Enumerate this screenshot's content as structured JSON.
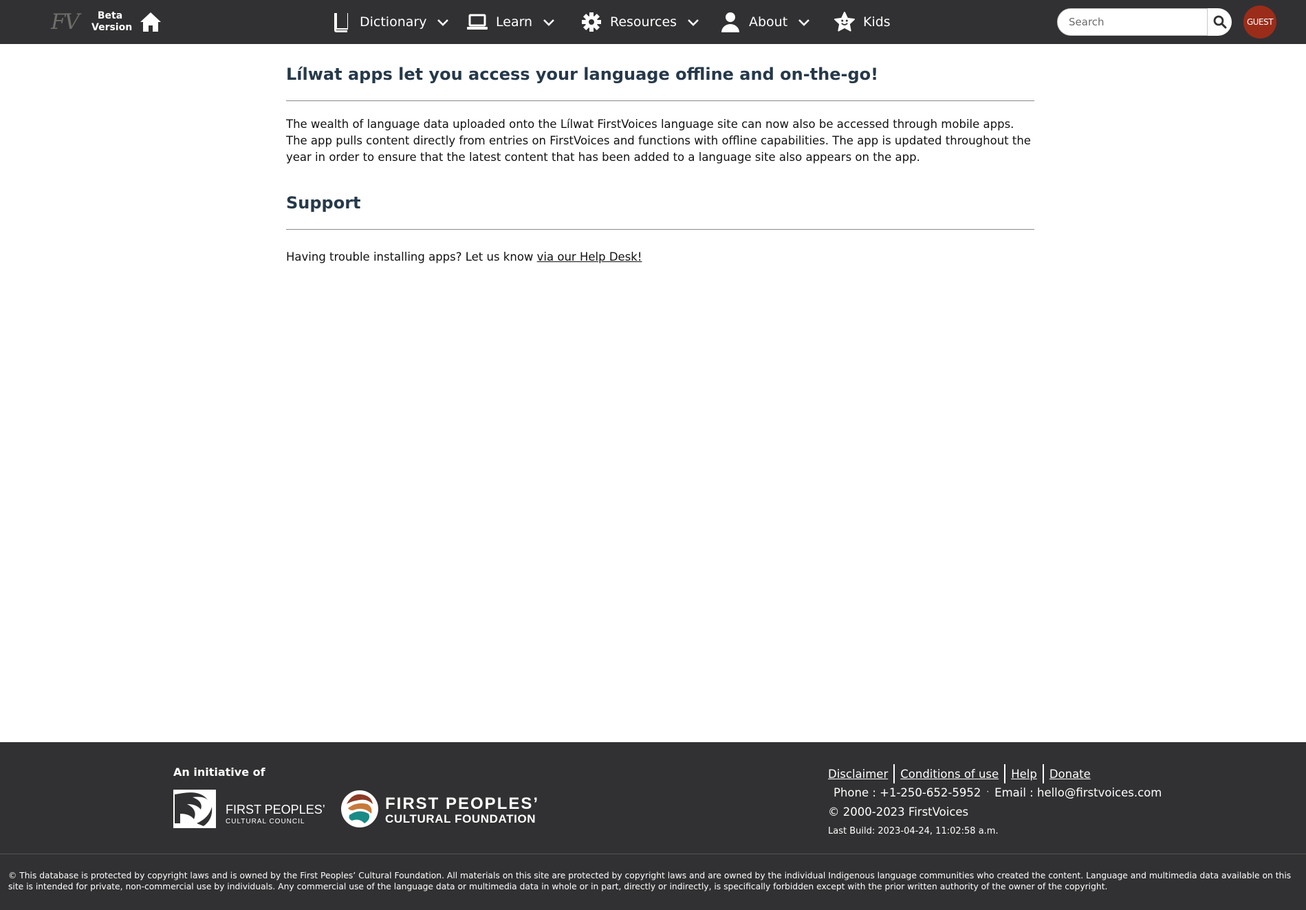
{
  "header": {
    "logo_text": "FV",
    "beta_line1": "Beta",
    "beta_line2": "Version",
    "nav": [
      {
        "label": "Dictionary",
        "icon": "book-icon"
      },
      {
        "label": "Learn",
        "icon": "laptop-icon"
      },
      {
        "label": "Resources",
        "icon": "gear-icon"
      },
      {
        "label": "About",
        "icon": "person-icon"
      },
      {
        "label": "Kids",
        "icon": "star-face-icon"
      }
    ],
    "search_placeholder": "Search",
    "user_label": "GUEST"
  },
  "main": {
    "title": "Lílwat apps let you access your language offline and on-the-go!",
    "intro": "The wealth of language data uploaded onto the Lílwat FirstVoices language site can now also be accessed through mobile apps. The app pulls content directly from entries on FirstVoices and functions with offline capabilities. The app is updated throughout the year in order to ensure that the latest content that has been added to a language site also appears on the app.",
    "support_title": "Support",
    "support_text": "Having trouble installing apps? Let us know ",
    "support_link": "via our Help Desk!"
  },
  "footer": {
    "initiative": "An initiative of",
    "fpcc_line1": "FIRST PEOPLES’",
    "fpcc_line2": "CULTURAL COUNCIL",
    "fpcf_line1": "FIRST PEOPLES’",
    "fpcf_line2": "CULTURAL FOUNDATION",
    "links": [
      "Disclaimer",
      "Conditions of use",
      "Help",
      "Donate"
    ],
    "phone": "Phone : +1-250-652-5952",
    "email": "Email : hello@firstvoices.com",
    "copyright": "© 2000-2023 FirstVoices",
    "last_build": "Last Build: 2023-04-24, 11:02:58 a.m.",
    "legal": "© This database is protected by copyright laws and is owned by the First Peoples’ Cultural Foundation. All materials on this site are protected by copyright laws and are owned by the individual Indigenous language communities who created the content. Language and multimedia data available on this site is intended for private, non-commercial use by individuals. Any commercial use of the language data or multimedia data in whole or in part, directly or indirectly, is specifically forbidden except with the prior written authority of the owner of the copyright."
  },
  "colors": {
    "bar": "#313133",
    "heading": "#26394a",
    "guest": "#9b2c1a"
  }
}
